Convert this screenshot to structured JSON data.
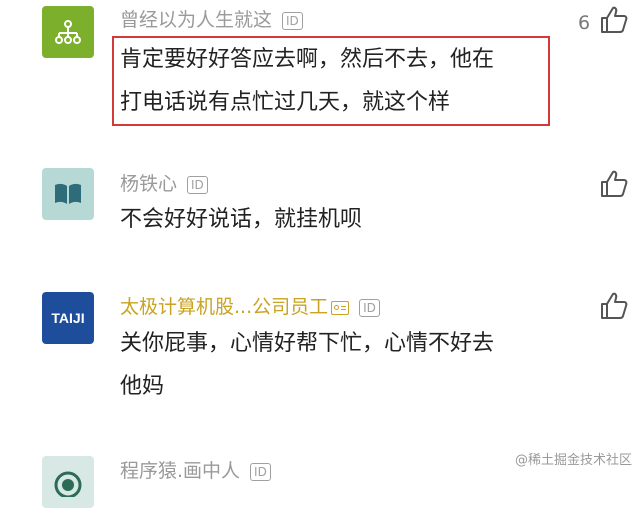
{
  "comments": [
    {
      "username": "曾经以为人生就这",
      "id_badge": "ID",
      "lines": [
        "肯定要好好答应去啊，然后不去，他在",
        "打电话说有点忙过几天，就这个样"
      ],
      "likes": "6",
      "avatar_icon": "sitemap-icon",
      "avatar_color": "#7cb02c"
    },
    {
      "username": "杨铁心",
      "id_badge": "ID",
      "lines": [
        "不会好好说话，就挂机呗"
      ],
      "likes": "",
      "avatar_icon": "book-icon",
      "avatar_color": "#b6d9d6"
    },
    {
      "username": "太极计算机股...公司员工",
      "id_badge": "ID",
      "lines": [
        "关你屁事，心情好帮下忙，心情不好去",
        "他妈"
      ],
      "likes": "",
      "avatar_text": "TAIJI",
      "avatar_color": "#1d4d9b",
      "name_color": "#c9a321"
    },
    {
      "username": "程序猿.画中人",
      "id_badge": "ID",
      "lines": [],
      "likes": "",
      "avatar_icon": "person-illustration-icon"
    }
  ],
  "watermark": "@稀土掘金技术社区",
  "highlight_color": "#d23a3a"
}
